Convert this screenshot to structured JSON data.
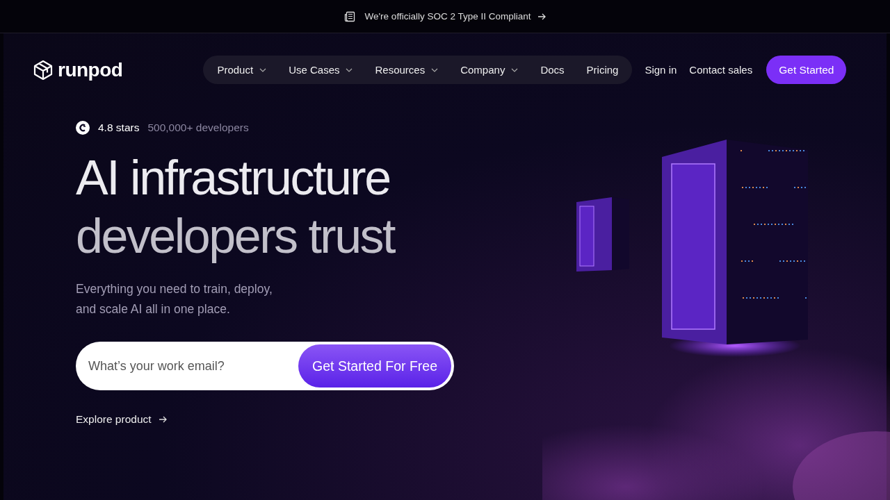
{
  "announcement": {
    "text": "We're officially SOC 2 Type II Compliant"
  },
  "header": {
    "logo": "runpod",
    "nav": [
      {
        "label": "Product",
        "has_menu": true
      },
      {
        "label": "Use Cases",
        "has_menu": true
      },
      {
        "label": "Resources",
        "has_menu": true
      },
      {
        "label": "Company",
        "has_menu": true
      },
      {
        "label": "Docs",
        "has_menu": false
      },
      {
        "label": "Pricing",
        "has_menu": false
      }
    ],
    "links": [
      "Sign in",
      "Contact sales"
    ],
    "cta": "Get Started"
  },
  "hero": {
    "rating": "4.8 stars",
    "developers": "500,000+ developers",
    "headline": [
      "AI infrastructure",
      "developers trust"
    ],
    "subtitle": [
      "Everything you need to train, deploy,",
      "and scale AI all in one place."
    ],
    "email": {
      "placeholder": "What’s your work email?"
    },
    "submit": "Get Started For Free",
    "explore": "Explore product"
  }
}
